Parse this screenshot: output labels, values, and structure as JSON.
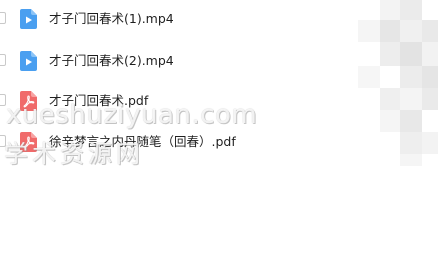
{
  "files": [
    {
      "name": "才子门回春术(1).mp4",
      "type": "video"
    },
    {
      "name": "才子门回春术(2).mp4",
      "type": "video"
    },
    {
      "name": "才子门回春术.pdf",
      "type": "pdf"
    },
    {
      "name": "徐辛梦言之内丹随笔（回春）.pdf",
      "type": "pdf"
    }
  ],
  "watermark": {
    "line1": "xueshuziyuan.com",
    "line2": "学术资源网"
  },
  "colors": {
    "video_icon": "#4a9ff0",
    "pdf_icon": "#f06a6a",
    "mosaic_light": "#f2f2f2",
    "mosaic_mid": "#e6e6e6"
  }
}
